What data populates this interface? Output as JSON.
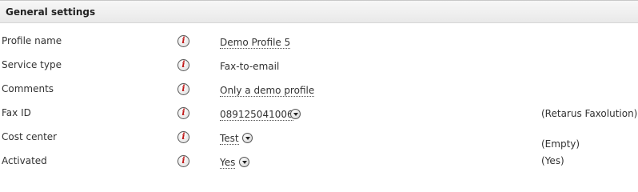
{
  "section": {
    "title": "General settings"
  },
  "rows": [
    {
      "label": "Profile name",
      "value": "Demo Profile 5"
    },
    {
      "label": "Service type",
      "value": "Fax-to-email"
    },
    {
      "label": "Comments",
      "value": "Only a demo profile"
    },
    {
      "label": "Fax ID",
      "value": "089125041006",
      "note": "(Retarus Faxolution)"
    },
    {
      "label": "Cost center",
      "value": "Test",
      "note": "(Empty)"
    },
    {
      "label": "Activated",
      "value": "Yes",
      "note": "(Yes)"
    }
  ],
  "icons": {
    "info": "info-icon",
    "dropdown": "chevron-down-icon"
  },
  "colors": {
    "info_letter": "#c01818",
    "header_bg": "#ececec"
  }
}
